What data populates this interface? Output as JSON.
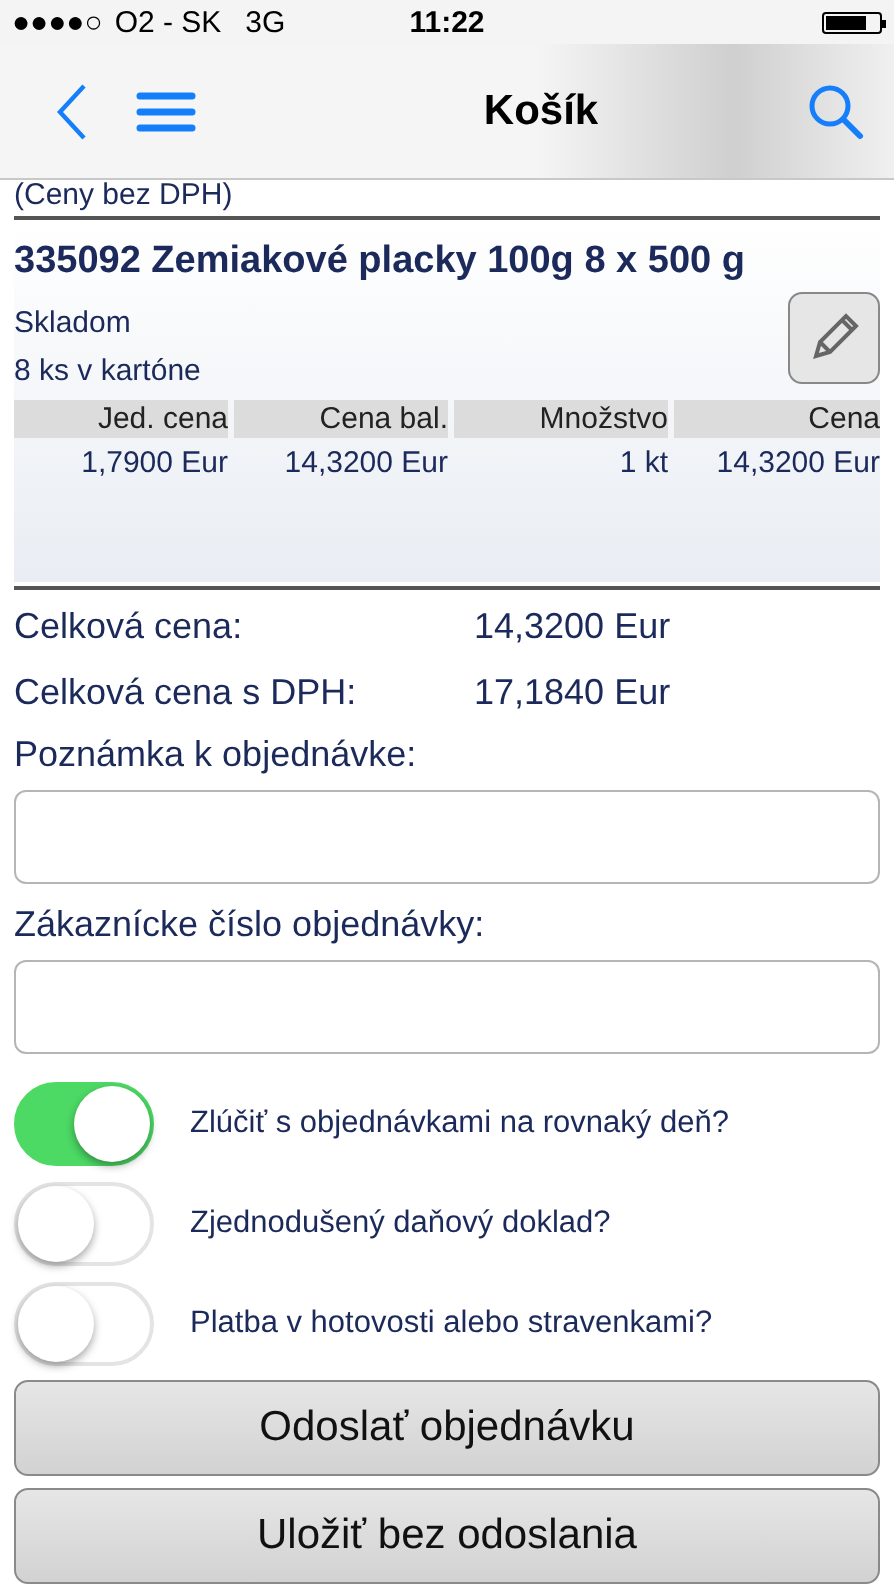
{
  "status_bar": {
    "signal": "●●●●○",
    "carrier": "O2 - SK",
    "network": "3G",
    "time": "11:22"
  },
  "nav": {
    "title": "Košík"
  },
  "price_note": "(Ceny bez DPH)",
  "item": {
    "title": "335092 Zemiakové placky 100g 8 x 500 g",
    "availability": "Skladom",
    "packaging": "8 ks v kartóne",
    "columns": [
      "Jed. cena",
      "Cena bal.",
      "Množstvo",
      "Cena"
    ],
    "row": [
      "1,7900 Eur",
      "14,3200 Eur",
      "1 kt",
      "14,3200 Eur"
    ]
  },
  "totals": [
    {
      "label": "Celková cena:",
      "value": "14,3200 Eur"
    },
    {
      "label": "Celková cena s DPH:",
      "value": "17,1840 Eur"
    }
  ],
  "fields": [
    {
      "label": "Poznámka k objednávke:"
    },
    {
      "label": "Zákaznícke číslo objednávky:"
    }
  ],
  "toggles": [
    {
      "label": "Zlúčiť s objednávkami na rovnaký deň?",
      "on": true
    },
    {
      "label": "Zjednodušený daňový doklad?",
      "on": false
    },
    {
      "label": "Platba v hotovosti alebo stravenkami?",
      "on": false
    }
  ],
  "buttons": [
    "Odoslať objednávku",
    "Uložiť bez odoslania"
  ]
}
